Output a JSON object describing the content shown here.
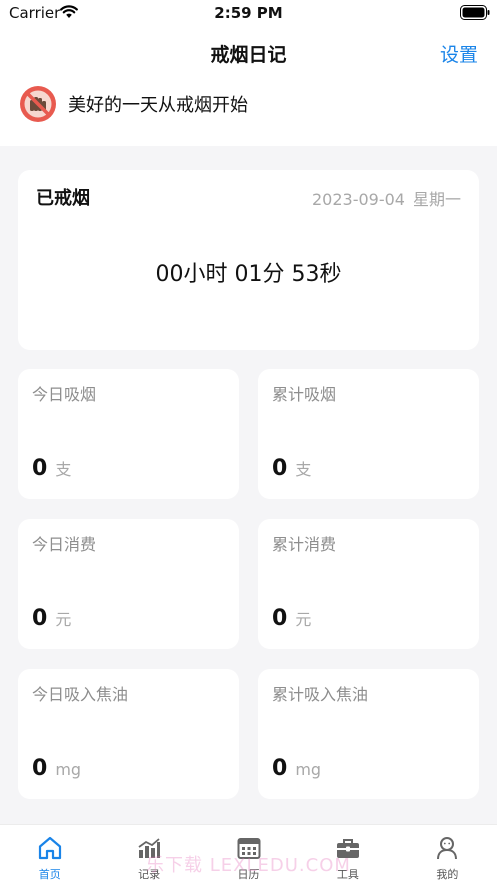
{
  "status_bar": {
    "carrier": "Carrier",
    "time": "2:59 PM"
  },
  "nav": {
    "title": "戒烟日记",
    "settings": "设置"
  },
  "banner": {
    "text": "美好的一天从戒烟开始",
    "icon": "no-smoking-icon"
  },
  "quit_card": {
    "label": "已戒烟",
    "date": "2023-09-04",
    "weekday": "星期一",
    "timer": "00小时 01分 53秒"
  },
  "stats": [
    {
      "label": "今日吸烟",
      "value": "0",
      "unit": "支"
    },
    {
      "label": "累计吸烟",
      "value": "0",
      "unit": "支"
    },
    {
      "label": "今日消费",
      "value": "0",
      "unit": "元"
    },
    {
      "label": "累计消费",
      "value": "0",
      "unit": "元"
    },
    {
      "label": "今日吸入焦油",
      "value": "0",
      "unit": "mg"
    },
    {
      "label": "累计吸入焦油",
      "value": "0",
      "unit": "mg"
    }
  ],
  "tabs": [
    {
      "label": "首页",
      "icon": "home-icon",
      "active": true
    },
    {
      "label": "记录",
      "icon": "chart-icon",
      "active": false
    },
    {
      "label": "日历",
      "icon": "calendar-icon",
      "active": false
    },
    {
      "label": "工具",
      "icon": "toolbox-icon",
      "active": false
    },
    {
      "label": "我的",
      "icon": "profile-icon",
      "active": false
    }
  ],
  "watermark": "乐下载 LEXLEDU.COM",
  "colors": {
    "accent": "#1a84e8",
    "background": "#f5f5f7",
    "card": "#ffffff",
    "muted": "#8e8e8e",
    "icon_red": "#e85a4f"
  }
}
